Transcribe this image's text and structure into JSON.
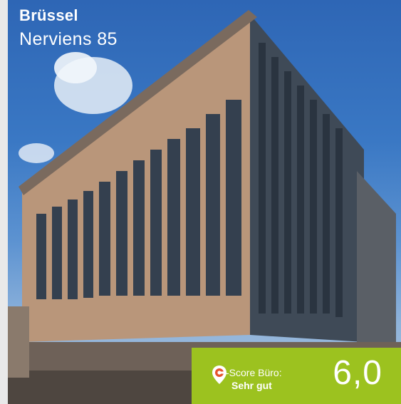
{
  "header": {
    "city": "Brüssel",
    "address": "Nerviens 85"
  },
  "score": {
    "label": "-Score Büro:",
    "rating": "Sehr gut",
    "value": "6,0",
    "icon": "location-pin-icon",
    "accent_color": "#9cc21f"
  }
}
